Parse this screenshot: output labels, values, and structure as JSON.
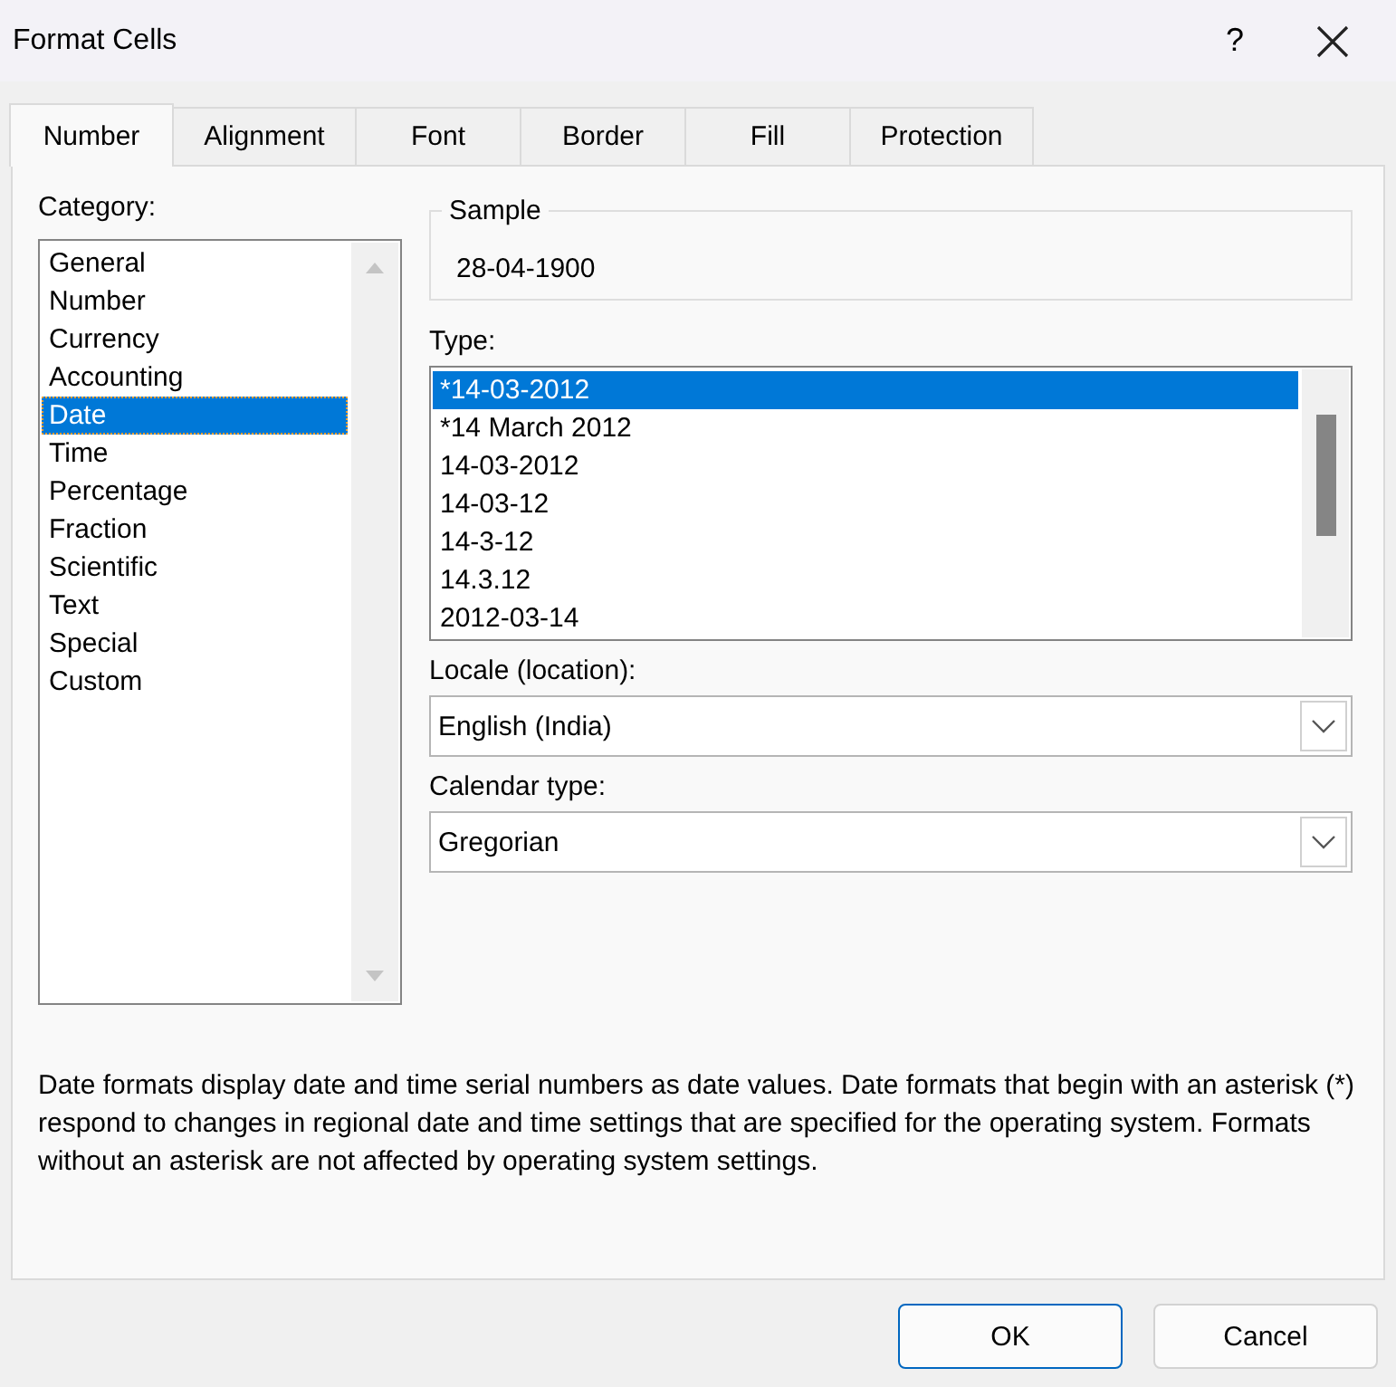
{
  "window": {
    "title": "Format Cells",
    "help": "?"
  },
  "tabs": [
    {
      "label": "Number",
      "selected": true
    },
    {
      "label": "Alignment",
      "selected": false
    },
    {
      "label": "Font",
      "selected": false
    },
    {
      "label": "Border",
      "selected": false
    },
    {
      "label": "Fill",
      "selected": false
    },
    {
      "label": "Protection",
      "selected": false
    }
  ],
  "category": {
    "label": "Category:",
    "items": [
      {
        "label": "General",
        "selected": false
      },
      {
        "label": "Number",
        "selected": false
      },
      {
        "label": "Currency",
        "selected": false
      },
      {
        "label": "Accounting",
        "selected": false
      },
      {
        "label": "Date",
        "selected": true
      },
      {
        "label": "Time",
        "selected": false
      },
      {
        "label": "Percentage",
        "selected": false
      },
      {
        "label": "Fraction",
        "selected": false
      },
      {
        "label": "Scientific",
        "selected": false
      },
      {
        "label": "Text",
        "selected": false
      },
      {
        "label": "Special",
        "selected": false
      },
      {
        "label": "Custom",
        "selected": false
      }
    ]
  },
  "sample": {
    "label": "Sample",
    "value": "28-04-1900"
  },
  "type": {
    "label": "Type:",
    "items": [
      {
        "label": "*14-03-2012",
        "selected": true
      },
      {
        "label": "*14 March 2012",
        "selected": false
      },
      {
        "label": "14-03-2012",
        "selected": false
      },
      {
        "label": "14-03-12",
        "selected": false
      },
      {
        "label": "14-3-12",
        "selected": false
      },
      {
        "label": "14.3.12",
        "selected": false
      },
      {
        "label": "2012-03-14",
        "selected": false
      }
    ]
  },
  "locale": {
    "label": "Locale (location):",
    "value": "English (India)"
  },
  "calendar": {
    "label": "Calendar type:",
    "value": "Gregorian"
  },
  "description": "Date formats display date and time serial numbers as date values.  Date formats that begin with an asterisk (*) respond to changes in regional date and time settings that are specified for the operating system. Formats without an asterisk are not affected by operating system settings.",
  "buttons": [
    {
      "label": "OK",
      "kind": "default"
    },
    {
      "label": "Cancel",
      "kind": "normal"
    }
  ]
}
